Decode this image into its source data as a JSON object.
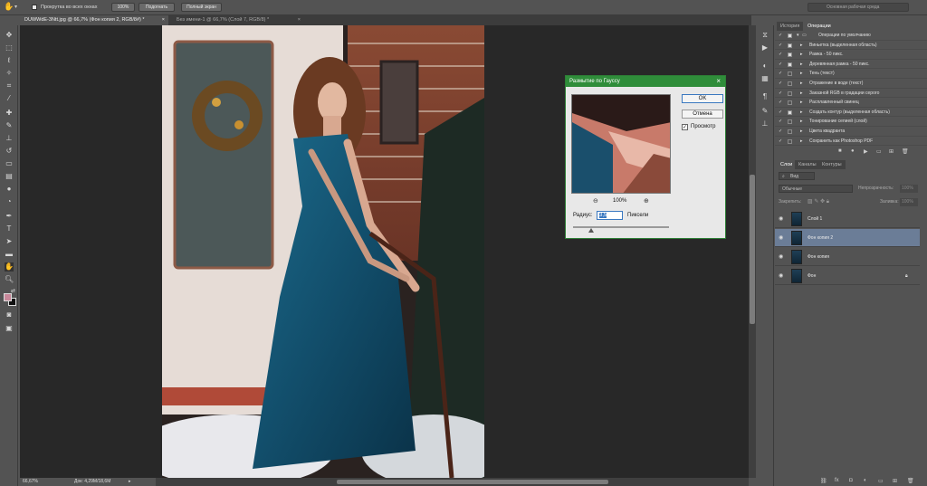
{
  "options_bar": {
    "scroll_all_label": "Прокрутка во всех окнах",
    "zoom_100": "100%",
    "fit_screen": "Подогнать",
    "full_screen": "Полный экран",
    "workspace": "Основная рабочая среда"
  },
  "tabs": [
    {
      "label": "DUWWdE-3Ntt.jpg @ 66,7% (Фон копия 2, RGB/8#) *"
    },
    {
      "label": "Без имени-1 @ 66,7% (Слой 7, RGB/8) *"
    }
  ],
  "dialog": {
    "title": "Размытие по Гауссу",
    "ok": "OK",
    "cancel": "Отмена",
    "preview": "Просмотр",
    "zoom": "100%",
    "radius_label": "Радиус:",
    "radius_value": "3,5",
    "units": "Пиксели"
  },
  "panel_tabs": {
    "history": "История",
    "actions": "Операции"
  },
  "actions": [
    "Операции по умолчанию",
    "Виньетка (выделенная область)",
    "Рамка - 50 пикс.",
    "Деревянная рамка - 50 пикс.",
    "Тень (текст)",
    "Отражение в воде (текст)",
    "Заказной RGB в градации серого",
    "Расплавленный свинец",
    "Создать контур (выделенная область)",
    "Тонирование сепией (слой)",
    "Цвета квадранта",
    "Сохранить как Photoshop PDF"
  ],
  "layers_tabs": {
    "layers": "Слои",
    "channels": "Каналы",
    "paths": "Контуры"
  },
  "layers_controls": {
    "kind": "Вид",
    "blend": "Обычные",
    "opacity_label": "Непрозрачность:",
    "opacity": "100%",
    "lock_label": "Закрепить:",
    "fill_label": "Заливка:",
    "fill": "100%"
  },
  "layers": [
    {
      "name": "Слой 1",
      "selected": false
    },
    {
      "name": "Фон копия 2",
      "selected": true
    },
    {
      "name": "Фон копия",
      "selected": false
    },
    {
      "name": "Фон",
      "selected": false
    }
  ],
  "status": {
    "zoom": "66,67%",
    "doc": "Док: 4,29М/18,6М"
  },
  "colors": {
    "dialog_title": "#2f8d3a",
    "selected_layer": "#6b7d97",
    "foreground": "#c8889a"
  }
}
